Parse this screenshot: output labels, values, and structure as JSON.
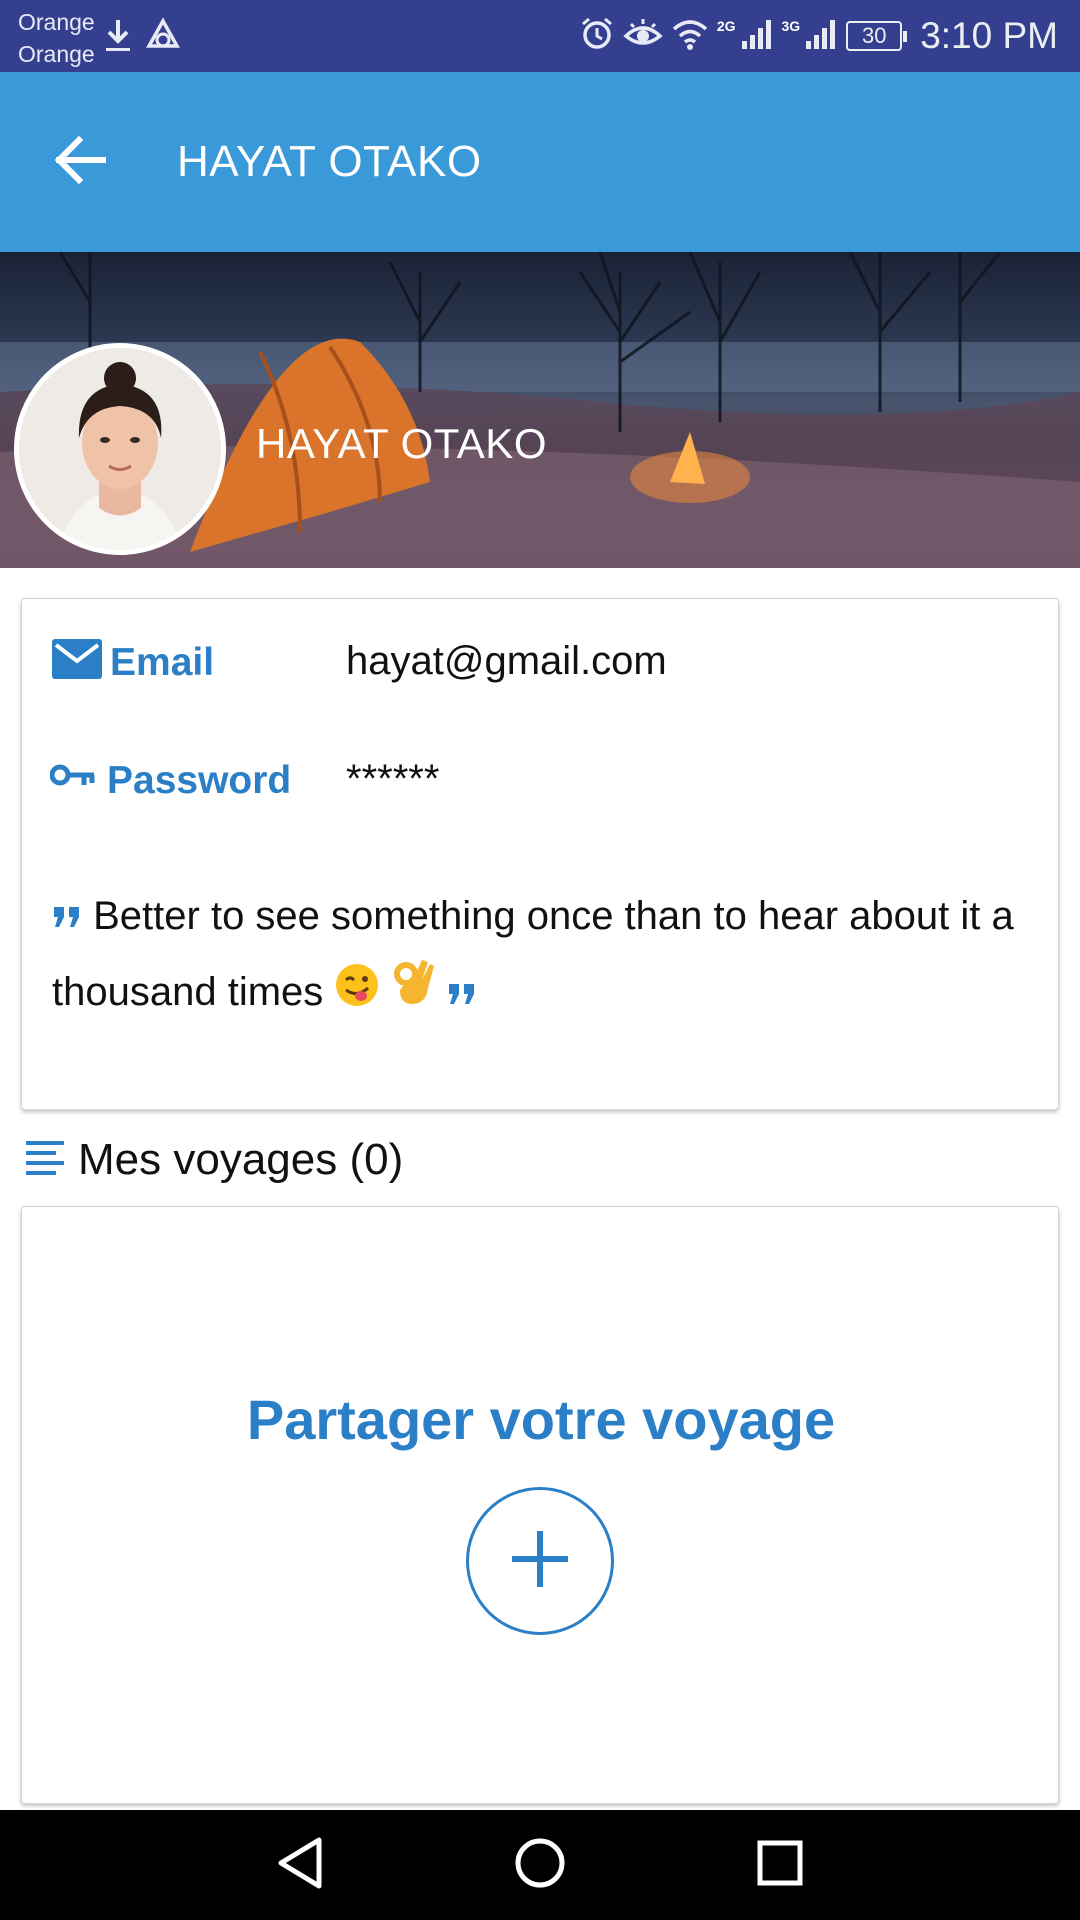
{
  "status_bar": {
    "carrier1": "Orange",
    "carrier2": "Orange",
    "net1": "2G",
    "net2": "3G",
    "battery": "30",
    "time": "3:10 PM",
    "icons": [
      "download-icon",
      "sync-icon",
      "alarm-icon",
      "eye-icon",
      "wifi-icon",
      "signal-icon",
      "battery-icon"
    ]
  },
  "app_bar": {
    "title": "HAYAT OTAKO",
    "back_icon": "arrow-back-icon",
    "background": "#3a9ad9"
  },
  "profile": {
    "name": "HAYAT OTAKO",
    "email_label": "Email",
    "email": "hayat@gmail.com",
    "password_label": "Password",
    "password": "******",
    "quote": "Better to see something once than to hear about it a thousand times",
    "quote_emojis": [
      "winking-tongue-emoji",
      "ok-hand-emoji"
    ]
  },
  "voyages": {
    "heading": "Mes voyages (0)",
    "share_title": "Partager votre voyage",
    "add_icon": "plus-icon"
  },
  "colors": {
    "accent": "#2a7fc6",
    "status_bar": "#34408f"
  },
  "nav_bar": {
    "icons": [
      "back-triangle-icon",
      "home-circle-icon",
      "recents-square-icon"
    ]
  }
}
